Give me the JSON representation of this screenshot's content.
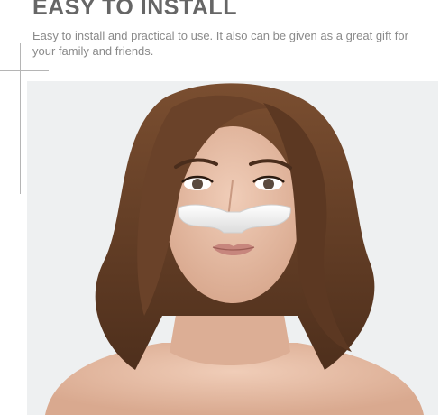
{
  "header": {
    "title": "EASY TO INSTALL",
    "description": "Easy to install and practical to use. It also can be given as a great gift for your family and friends."
  },
  "photo": {
    "subject": "woman-wearing-nose-strip",
    "colors": {
      "background": "#eef0f1",
      "hair": "#6a4229",
      "skin": "#e5bea8",
      "lips": "#c7867d",
      "product": "#f3f3f3"
    }
  }
}
